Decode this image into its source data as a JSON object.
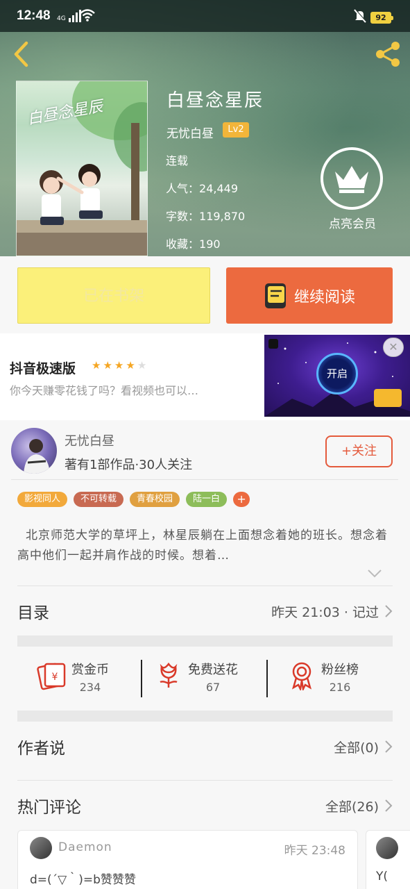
{
  "status_bar": {
    "time": "12:48",
    "network": "4G",
    "battery": "92"
  },
  "book": {
    "title": "白昼念星辰",
    "author": "无忧白昼",
    "author_level": "Lv2",
    "status": "连载",
    "popularity_label": "人气：",
    "popularity": "24,449",
    "word_count_label": "字数：",
    "word_count": "119,870",
    "favorites_label": "收藏：",
    "favorites": "190"
  },
  "vip": {
    "label": "点亮会员"
  },
  "actions": {
    "shelf_label": "已在书架",
    "read_label": "继续阅读"
  },
  "ad": {
    "title": "抖音极速版",
    "rating_stars": 4,
    "subtitle": "你今天赚零花钱了吗？看视频也可以…",
    "open_label": "开启",
    "close_symbol": "✕"
  },
  "author_card": {
    "name": "无忧白昼",
    "stats": "著有1部作品·30人关注",
    "follow_label": "+关注"
  },
  "tags": [
    {
      "label": "影视同人",
      "color": "#f2a93b"
    },
    {
      "label": "不可转载",
      "color": "#c86a52"
    },
    {
      "label": "青春校园",
      "color": "#e0a040"
    },
    {
      "label": "陆一白",
      "color": "#8dbd5a"
    },
    {
      "label": "+",
      "color": "#ec6a3f"
    }
  ],
  "synopsis": "北京师范大学的草坪上，林星辰躺在上面想念着她的班长。想念着高中他们一起并肩作战的时候。想着…",
  "catalog": {
    "title": "目录",
    "update": "昨天 21:03 · 记过"
  },
  "stats": [
    {
      "label": "赏金币",
      "value": "234",
      "icon": "red-envelope-icon"
    },
    {
      "label": "免费送花",
      "value": "67",
      "icon": "flower-icon"
    },
    {
      "label": "粉丝榜",
      "value": "216",
      "icon": "medal-icon"
    }
  ],
  "author_says": {
    "title": "作者说",
    "link": "全部(0)"
  },
  "hot_comments": {
    "title": "热门评论",
    "link": "全部(26)"
  },
  "comments": [
    {
      "user": "Daemon",
      "time": "昨天 23:48",
      "text": "d=(´▽｀)=b赞赞赞"
    },
    {
      "user": "",
      "time": "",
      "text": "Y("
    }
  ],
  "colors": {
    "accent": "#ec6a3f",
    "shelf_button": "#fbf07a",
    "level_badge": "#f2b53a"
  }
}
